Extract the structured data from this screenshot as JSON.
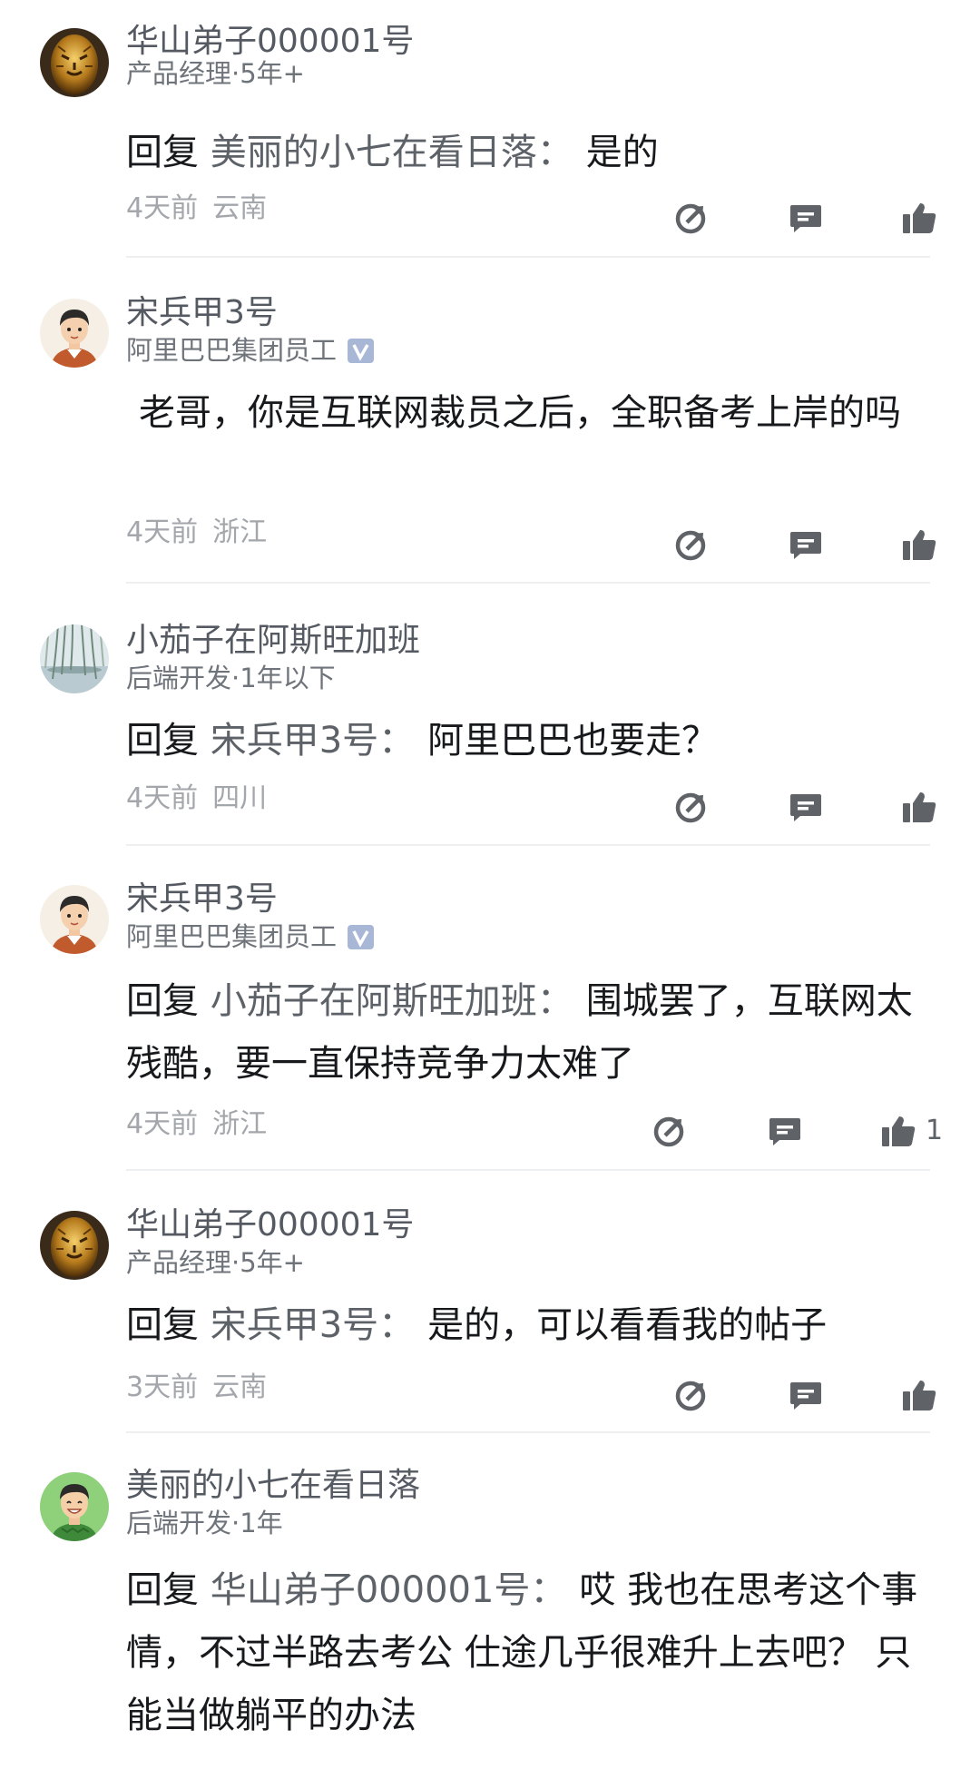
{
  "comments": [
    {
      "username": "华山弟子000001号",
      "subtitle": "产品经理·5年+",
      "verified": false,
      "avatar_icon": "golden-tiger-avatar-icon",
      "reply_prefix": "回复",
      "reply_target": "美丽的小七在看日落",
      "reply_colon": "：",
      "text": "是的",
      "time": "4天前",
      "location": "云南",
      "like_count": ""
    },
    {
      "username": "宋兵甲3号",
      "subtitle": "阿里巴巴集团员工",
      "verified": true,
      "avatar_icon": "cartoon-boy-avatar-icon",
      "reply_prefix": "",
      "reply_target": "",
      "reply_colon": "",
      "text": "老哥，你是互联网裁员之后，全职备考上岸的吗",
      "time": "4天前",
      "location": "浙江",
      "like_count": ""
    },
    {
      "username": "小茄子在阿斯旺加班",
      "subtitle": "后端开发·1年以下",
      "verified": false,
      "avatar_icon": "willow-landscape-avatar-icon",
      "reply_prefix": "回复",
      "reply_target": "宋兵甲3号",
      "reply_colon": "：",
      "text": "阿里巴巴也要走？",
      "time": "4天前",
      "location": "四川",
      "like_count": ""
    },
    {
      "username": "宋兵甲3号",
      "subtitle": "阿里巴巴集团员工",
      "verified": true,
      "avatar_icon": "cartoon-boy-avatar-icon",
      "reply_prefix": "回复",
      "reply_target": "小茄子在阿斯旺加班",
      "reply_colon": "：",
      "text": "围城罢了，互联网太残酷，要一直保持竞争力太难了",
      "time": "4天前",
      "location": "浙江",
      "like_count": "1"
    },
    {
      "username": "华山弟子000001号",
      "subtitle": "产品经理·5年+",
      "verified": false,
      "avatar_icon": "golden-tiger-avatar-icon",
      "reply_prefix": "回复",
      "reply_target": "宋兵甲3号",
      "reply_colon": "：",
      "text": "是的，可以看看我的帖子",
      "time": "3天前",
      "location": "云南",
      "like_count": ""
    },
    {
      "username": "美丽的小七在看日落",
      "subtitle": "后端开发·1年",
      "verified": false,
      "avatar_icon": "smiling-man-avatar-icon",
      "reply_prefix": "回复",
      "reply_target": "华山弟子000001号",
      "reply_colon": "：",
      "text": "哎 我也在思考这个事情，不过半路去考公 仕途几乎很难升上去吧？ 只能当做躺平的办法",
      "time": "",
      "location": "",
      "like_count": ""
    }
  ],
  "icons": {
    "share": "share-icon",
    "comment": "comment-icon",
    "like": "like-icon",
    "verified": "verified-v-icon"
  },
  "colors": {
    "icon": "#5f6368",
    "meta_text": "#a3a6ab",
    "verified_badge": "#a9b7d6",
    "divider": "#eeeff1"
  }
}
